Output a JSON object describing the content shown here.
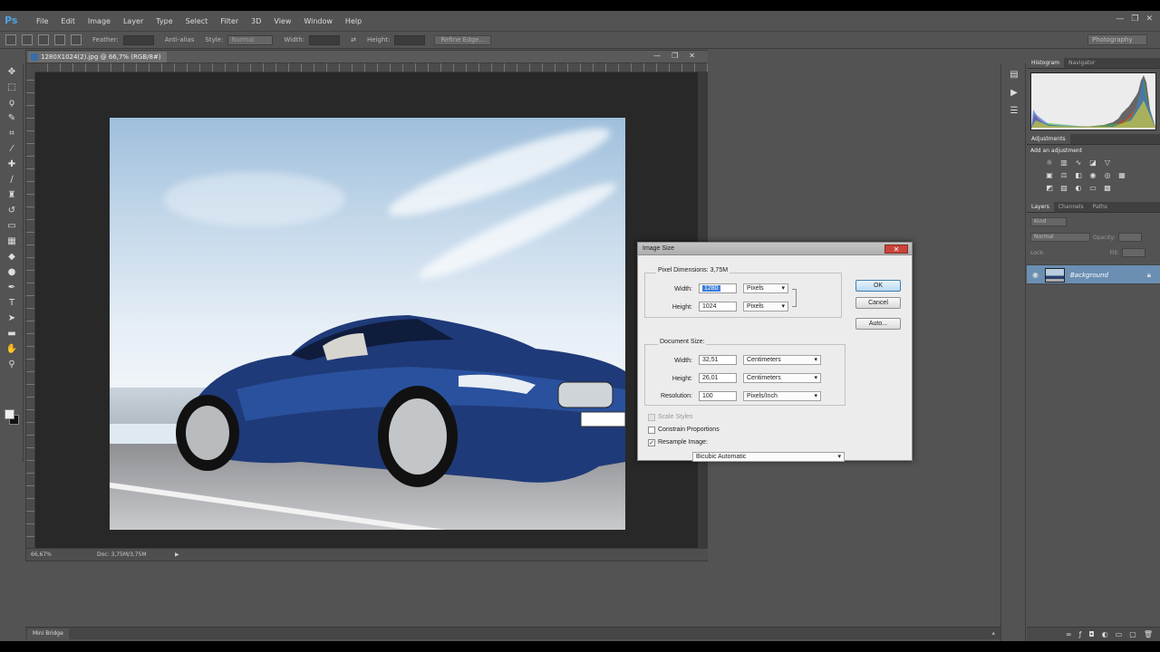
{
  "app": {
    "logo": "Ps"
  },
  "menu": [
    "File",
    "Edit",
    "Image",
    "Layer",
    "Type",
    "Select",
    "Filter",
    "3D",
    "View",
    "Window",
    "Help"
  ],
  "window_controls": [
    "—",
    "❐",
    "✕"
  ],
  "options": {
    "feather_label": "Feather:",
    "antialias_label": "Anti-alias",
    "style_label": "Style:",
    "style_value": "Normal",
    "width_label": "Width:",
    "height_label": "Height:",
    "refine_button": "Refine Edge...",
    "workspace": "Photography"
  },
  "document": {
    "tab_title": "1280X1024(2).jpg @ 66,7% (RGB/8#)",
    "zoom": "66,67%",
    "doc_info": "Doc: 3,75M/3,75M",
    "status_arrow": "▶",
    "controls": [
      "—",
      "❐",
      "✕"
    ]
  },
  "dialog": {
    "title": "Image Size",
    "close": "✕",
    "pixel_dimensions_label": "Pixel Dimensions:",
    "pixel_dimensions_value": "3,75M",
    "pixel_width_label": "Width:",
    "pixel_width_value": "1280",
    "pixel_width_unit": "Pixels",
    "pixel_height_label": "Height:",
    "pixel_height_value": "1024",
    "pixel_height_unit": "Pixels",
    "document_size_label": "Document Size:",
    "doc_width_label": "Width:",
    "doc_width_value": "32,51",
    "doc_width_unit": "Centimeters",
    "doc_height_label": "Height:",
    "doc_height_value": "26,01",
    "doc_height_unit": "Centimeters",
    "resolution_label": "Resolution:",
    "resolution_value": "100",
    "resolution_unit": "Pixels/Inch",
    "scale_styles": "Scale Styles",
    "scale_styles_checked": false,
    "constrain_label": "Constrain Proportions",
    "constrain_checked": false,
    "resample_label": "Resample Image:",
    "resample_checked": true,
    "resample_method": "Bicubic Automatic",
    "ok": "OK",
    "cancel": "Cancel",
    "auto": "Auto..."
  },
  "panels": {
    "top_tabs": [
      "Histogram",
      "Navigator"
    ],
    "adjustments_tab": "Adjustments",
    "add_adjustment": "Add an adjustment",
    "layer_tabs": [
      "Layers",
      "Channels",
      "Paths"
    ],
    "kind": "Kind",
    "blend_mode": "Normal",
    "opacity_label": "Opacity:",
    "lock_label": "Lock:",
    "fill_label": "Fill:",
    "layer_name": "Background"
  },
  "mini_bridge_label": "Mini Bridge",
  "colors": {
    "accent": "#3a7dd8",
    "layer_selected": "#6b8fb3",
    "panel_bg": "#535353"
  }
}
